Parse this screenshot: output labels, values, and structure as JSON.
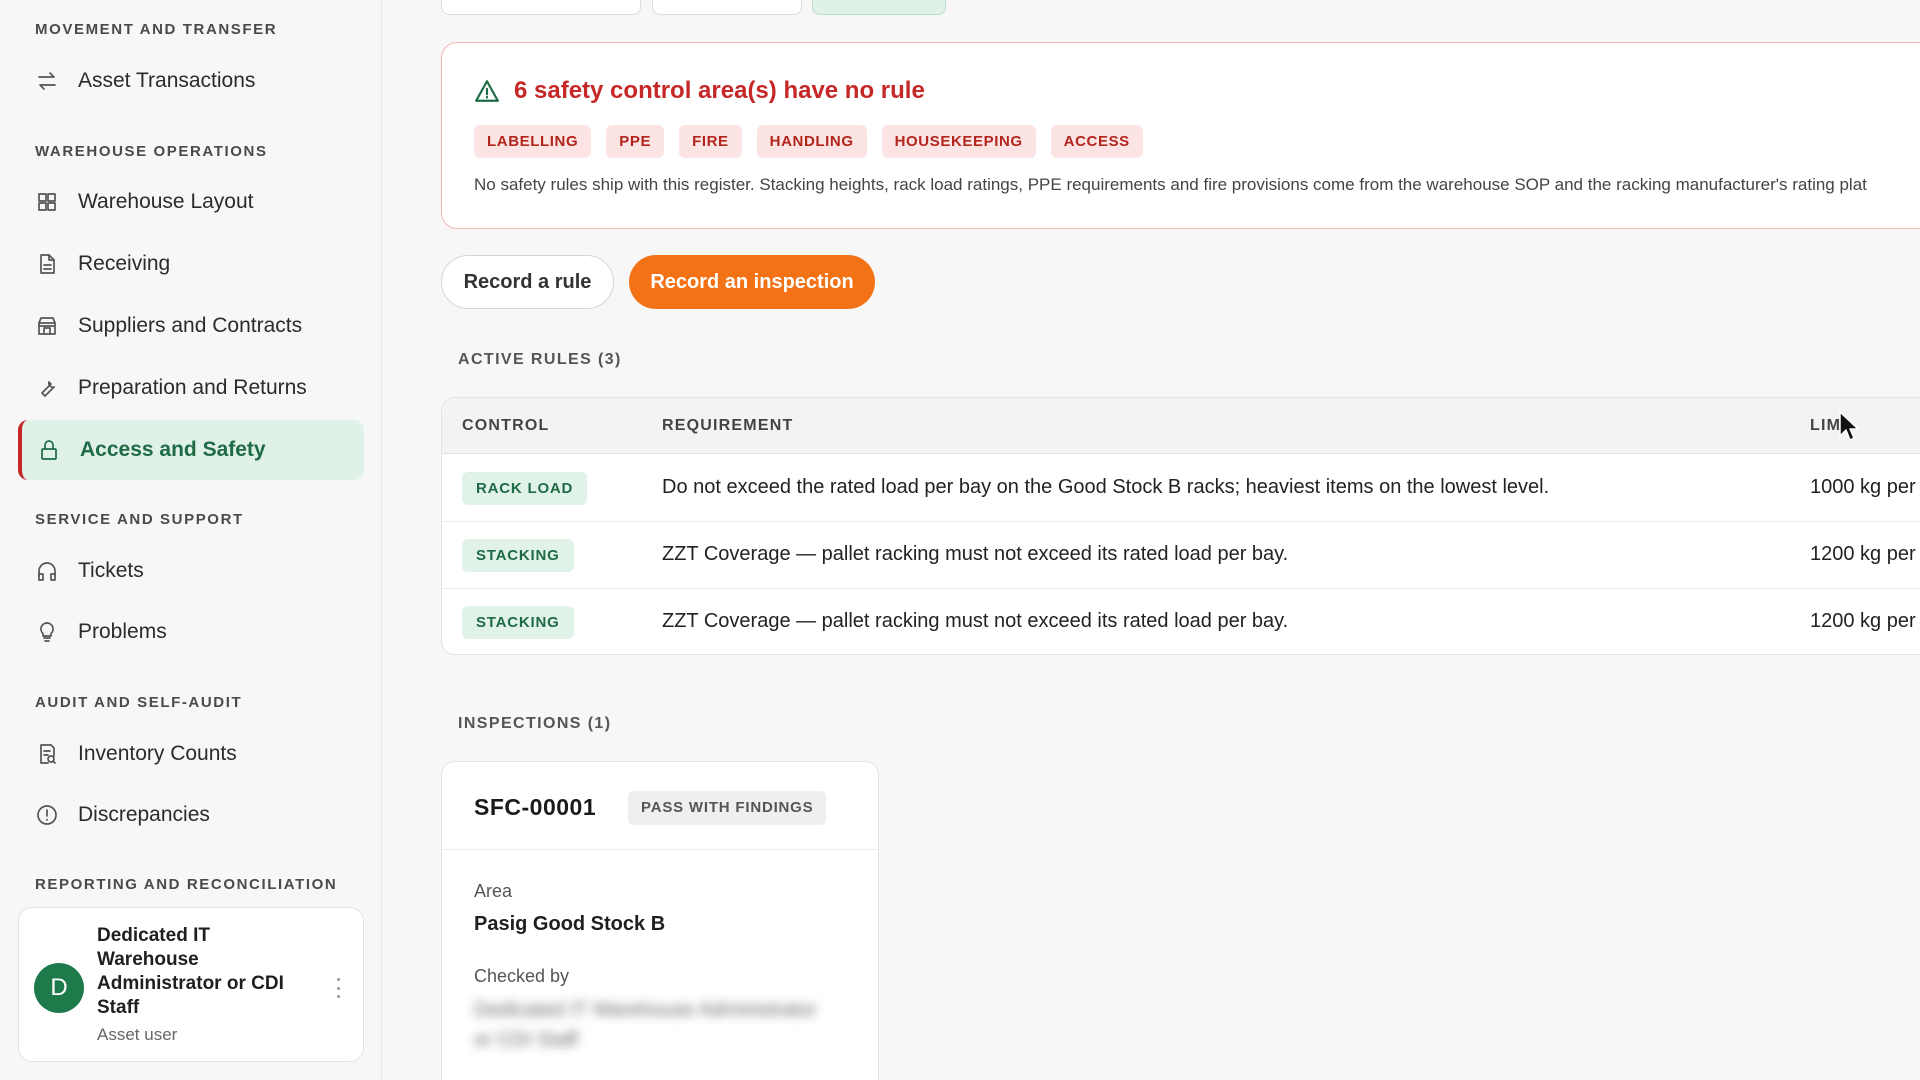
{
  "sidebar": {
    "sections": [
      {
        "title": "MOVEMENT AND TRANSFER",
        "items": [
          {
            "label": "Asset Transactions",
            "icon": "arrows-exchange-icon"
          }
        ]
      },
      {
        "title": "WAREHOUSE OPERATIONS",
        "items": [
          {
            "label": "Warehouse Layout",
            "icon": "grid-icon"
          },
          {
            "label": "Receiving",
            "icon": "document-icon"
          },
          {
            "label": "Suppliers and Contracts",
            "icon": "store-icon"
          },
          {
            "label": "Preparation and Returns",
            "icon": "wrench-icon"
          },
          {
            "label": "Access and Safety",
            "icon": "lock-icon",
            "active": true
          }
        ]
      },
      {
        "title": "SERVICE AND SUPPORT",
        "items": [
          {
            "label": "Tickets",
            "icon": "headphones-icon"
          },
          {
            "label": "Problems",
            "icon": "lightbulb-icon"
          }
        ]
      },
      {
        "title": "AUDIT AND SELF-AUDIT",
        "items": [
          {
            "label": "Inventory Counts",
            "icon": "clipboard-search-icon"
          },
          {
            "label": "Discrepancies",
            "icon": "alert-circle-icon"
          }
        ]
      },
      {
        "title": "REPORTING AND RECONCILIATION",
        "items": []
      }
    ],
    "user": {
      "initial": "D",
      "name": "Dedicated IT Warehouse Administrator or CDI Staff",
      "role": "Asset user"
    }
  },
  "alert": {
    "title": "6 safety control area(s) have no rule",
    "chips": [
      "LABELLING",
      "PPE",
      "FIRE",
      "HANDLING",
      "HOUSEKEEPING",
      "ACCESS"
    ],
    "note": "No safety rules ship with this register. Stacking heights, rack load ratings, PPE requirements and fire provisions come from the warehouse SOP and the racking manufacturer's rating plat"
  },
  "actions": {
    "record_rule": "Record a rule",
    "record_inspection": "Record an inspection"
  },
  "rules": {
    "section_label": "ACTIVE RULES (3)",
    "columns": {
      "control": "CONTROL",
      "requirement": "REQUIREMENT",
      "limit": "LIM"
    },
    "rows": [
      {
        "control": "RACK LOAD",
        "requirement": "Do not exceed the rated load per bay on the Good Stock B racks; heaviest items on the lowest level.",
        "limit": "1000 kg per"
      },
      {
        "control": "STACKING",
        "requirement": "ZZT Coverage — pallet racking must not exceed its rated load per bay.",
        "limit": "1200 kg per"
      },
      {
        "control": "STACKING",
        "requirement": "ZZT Coverage — pallet racking must not exceed its rated load per bay.",
        "limit": "1200 kg per"
      }
    ]
  },
  "inspections": {
    "section_label": "INSPECTIONS (1)",
    "card": {
      "id": "SFC-00001",
      "status": "PASS WITH FINDINGS",
      "area_label": "Area",
      "area_value": "Pasig Good Stock B",
      "checked_by_label": "Checked by",
      "checked_by_value": "Dedicated IT Warehouse Administrator or CDI Staff"
    }
  },
  "colors": {
    "accent_green": "#1e6b45",
    "alert_red": "#c62828",
    "primary_orange": "#f47216"
  }
}
